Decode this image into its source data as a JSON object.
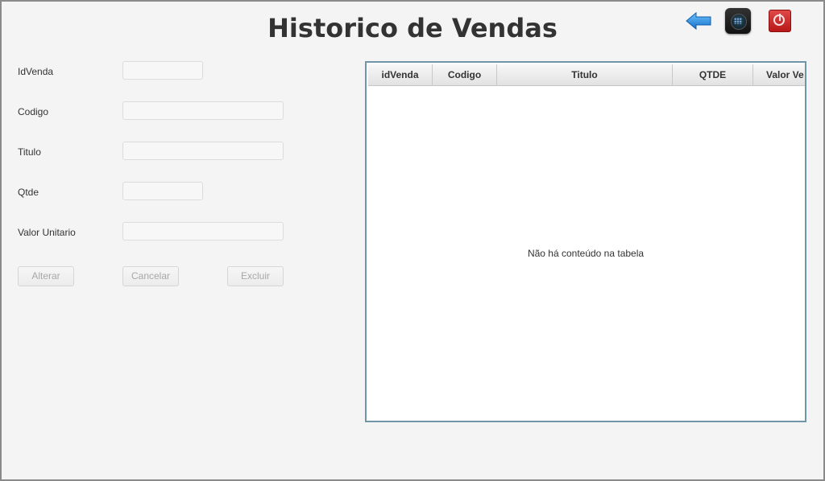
{
  "header": {
    "title": "Historico de Vendas"
  },
  "toolbar": {
    "icons": [
      "back-arrow-icon",
      "menu-grid-icon",
      "power-icon"
    ],
    "colors": {
      "back_arrow": "#1e8de0",
      "power": "#d23232"
    }
  },
  "form": {
    "idvenda_label": "IdVenda",
    "idvenda_value": "",
    "codigo_label": "Codigo",
    "codigo_value": "",
    "titulo_label": "Titulo",
    "titulo_value": "",
    "qtde_label": "Qtde",
    "qtde_value": "",
    "valor_label": "Valor Unitario",
    "valor_value": ""
  },
  "actions": {
    "alterar": "Alterar",
    "cancelar": "Cancelar",
    "excluir": "Excluir"
  },
  "table": {
    "columns": [
      "idVenda",
      "Codigo",
      "Titulo",
      "QTDE",
      "Valor Ve"
    ],
    "rows": [],
    "empty_message": "Não há conteúdo na tabela"
  }
}
